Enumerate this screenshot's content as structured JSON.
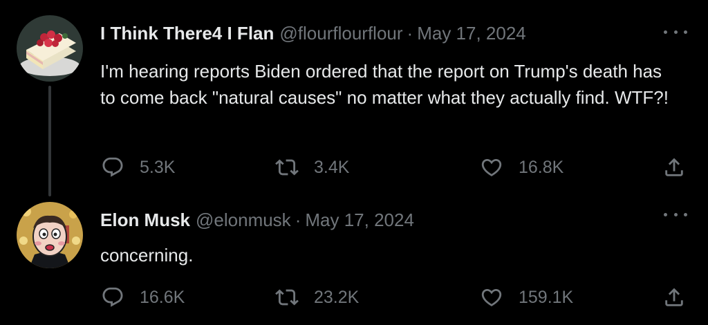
{
  "tweets": [
    {
      "author_name": "I Think There4 I Flan",
      "handle": "@flourflourflour",
      "separator": "·",
      "date": "May 17, 2024",
      "text": "I'm hearing reports Biden ordered that the report on Trump's death has to come back \"natural causes\" no matter what they actually find. WTF?!",
      "avatar_icon": "cake-slice-avatar",
      "stats": {
        "replies": "5.3K",
        "retweets": "3.4K",
        "likes": "16.8K"
      }
    },
    {
      "author_name": "Elon Musk",
      "handle": "@elonmusk",
      "separator": "·",
      "date": "May 17, 2024",
      "text": "concerning.",
      "avatar_icon": "cartoon-face-avatar",
      "stats": {
        "replies": "16.6K",
        "retweets": "23.2K",
        "likes": "159.1K"
      }
    }
  ],
  "icons": [
    "reply-icon",
    "retweet-icon",
    "like-icon",
    "share-icon",
    "more-icon"
  ],
  "colors": {
    "background": "#000000",
    "text": "#e7e9ea",
    "muted": "#71767b",
    "thread_line": "#333639"
  }
}
